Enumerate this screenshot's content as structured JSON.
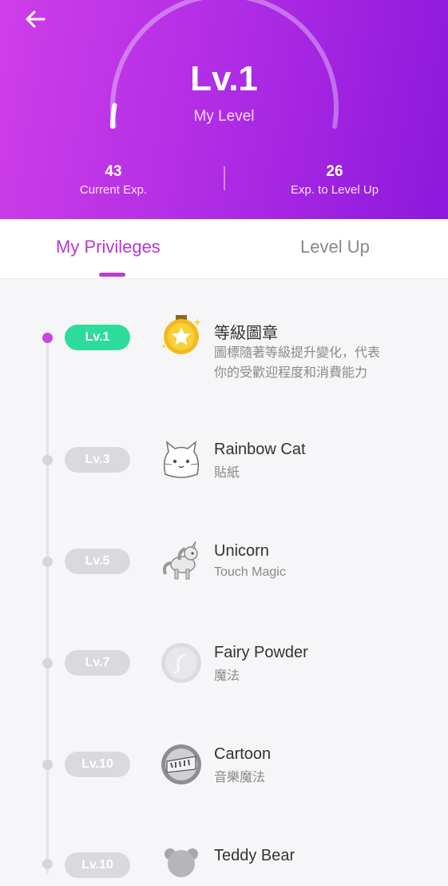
{
  "header": {
    "back_icon": "arrow-left-icon",
    "level_value": "Lv.1",
    "level_label": "My Level",
    "current_exp_value": "43",
    "current_exp_label": "Current Exp.",
    "exp_to_level_up_value": "26",
    "exp_to_level_up_label": "Exp. to Level Up",
    "progress_fraction": 0.06,
    "gradient_colors": [
      "#cf3ee8",
      "#8d18db"
    ]
  },
  "tabs": [
    {
      "label": "My Privileges",
      "active": true
    },
    {
      "label": "Level Up",
      "active": false
    }
  ],
  "colors": {
    "accent": "#b53ad4",
    "active_badge": "#2ddc9c",
    "inactive_badge": "#dadade"
  },
  "privileges": [
    {
      "level": "Lv.1",
      "active": true,
      "icon": "gold-medal-icon",
      "title": "等級圖章",
      "desc": [
        "圖標隨著等級提升變化，代表",
        "你的受歡迎程度和消費能力"
      ]
    },
    {
      "level": "Lv.3",
      "active": false,
      "icon": "cat-sticker-icon",
      "title": "Rainbow Cat",
      "desc": [
        "貼紙"
      ]
    },
    {
      "level": "Lv.5",
      "active": false,
      "icon": "unicorn-icon",
      "title": "Unicorn",
      "desc": [
        "Touch Magic"
      ]
    },
    {
      "level": "Lv.7",
      "active": false,
      "icon": "fairy-powder-icon",
      "title": "Fairy Powder",
      "desc": [
        "魔法"
      ]
    },
    {
      "level": "Lv.10",
      "active": false,
      "icon": "cool-cartoon-icon",
      "title": "Cartoon",
      "desc": [
        "音樂魔法"
      ]
    },
    {
      "level": "Lv.10",
      "active": false,
      "icon": "teddy-bear-icon",
      "title": "Teddy Bear",
      "desc": []
    }
  ]
}
